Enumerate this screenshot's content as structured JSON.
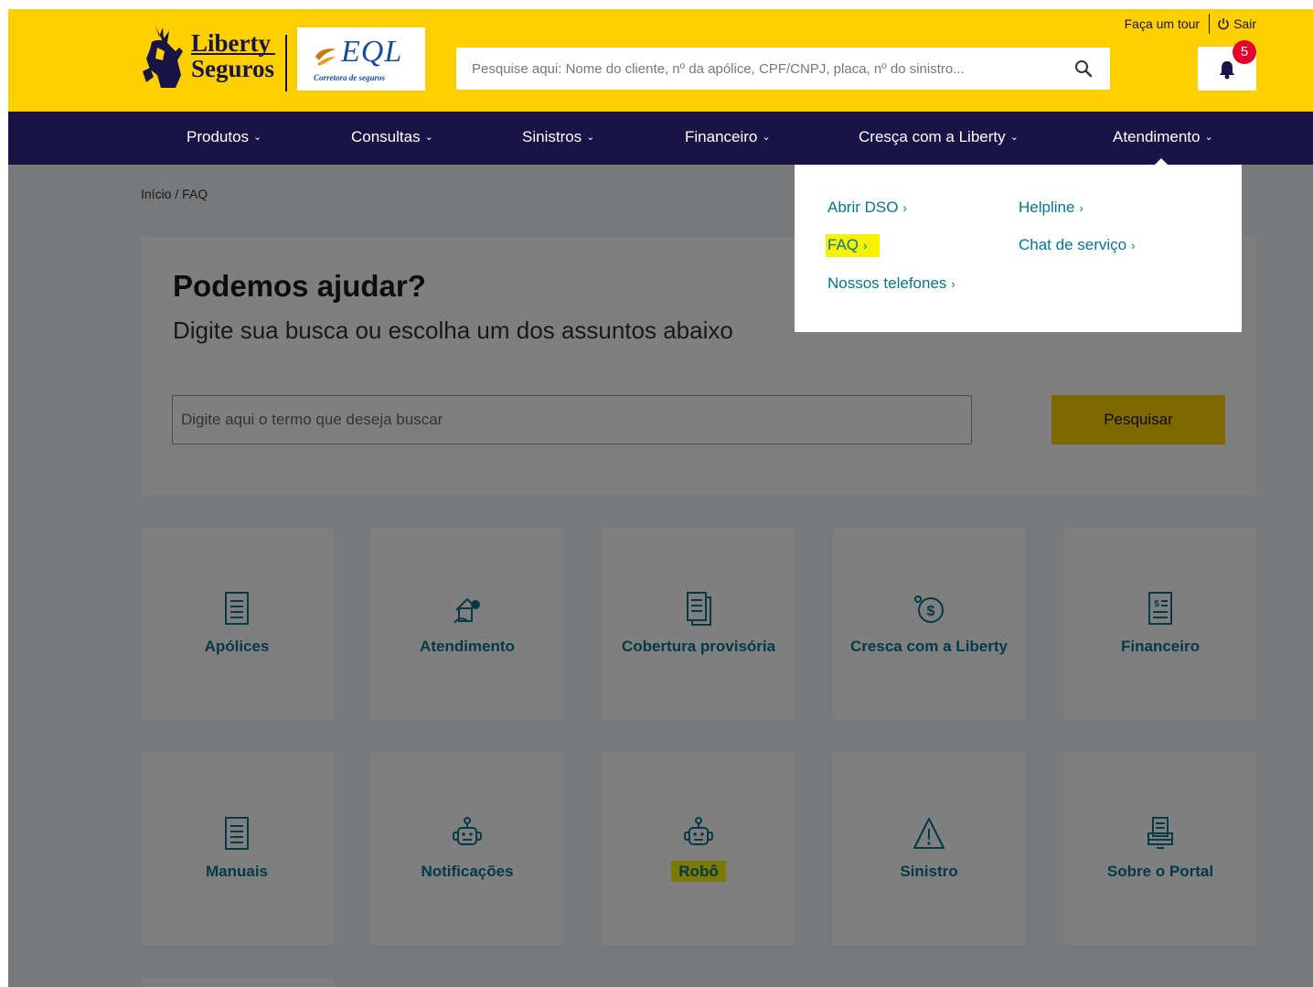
{
  "header": {
    "brand": {
      "line1": "Liberty",
      "line2": "Seguros"
    },
    "partner": {
      "name": "EQL",
      "tagline": "Corretora de seguros"
    },
    "search": {
      "placeholder": "Pesquise aqui: Nome do cliente, nº da apólice, CPF/CNPJ, placa, nº do sinistro..."
    },
    "tour_link": "Faça um tour",
    "logout_link": "Sair",
    "notifications_count": "5",
    "colors": {
      "brand_yellow": "#ffd000",
      "navy": "#1a1446",
      "teal": "#06748c",
      "badge_red": "#e4002b",
      "highlight": "#f7f200"
    }
  },
  "nav": {
    "items": [
      {
        "label": "Produtos"
      },
      {
        "label": "Consultas"
      },
      {
        "label": "Sinistros"
      },
      {
        "label": "Financeiro"
      },
      {
        "label": "Cresça com a Liberty"
      },
      {
        "label": "Atendimento"
      }
    ]
  },
  "dropdown": {
    "col1": [
      {
        "label": "Abrir DSO"
      },
      {
        "label": "FAQ"
      },
      {
        "label": "Nossos telefones"
      }
    ],
    "col2": [
      {
        "label": "Helpline"
      },
      {
        "label": "Chat de serviço"
      }
    ]
  },
  "breadcrumb": "Início / FAQ",
  "help": {
    "title": "Podemos ajudar?",
    "subtitle": "Digite sua busca ou escolha um dos assuntos abaixo",
    "input_placeholder": "Digite aqui o termo que deseja buscar",
    "button_label": "Pesquisar"
  },
  "topics": [
    {
      "label": "Apólices",
      "icon": "document-icon"
    },
    {
      "label": "Atendimento",
      "icon": "support-icon"
    },
    {
      "label": "Cobertura provisória",
      "icon": "documents-icon"
    },
    {
      "label": "Cresca com a Liberty",
      "icon": "money-growth-icon"
    },
    {
      "label": "Financeiro",
      "icon": "invoice-icon"
    },
    {
      "label": "Manuais",
      "icon": "document-icon"
    },
    {
      "label": "Notificações",
      "icon": "robot-icon"
    },
    {
      "label": "Robô",
      "icon": "robot-icon"
    },
    {
      "label": "Sinistro",
      "icon": "warning-icon"
    },
    {
      "label": "Sobre o Portal",
      "icon": "portal-icon"
    }
  ]
}
